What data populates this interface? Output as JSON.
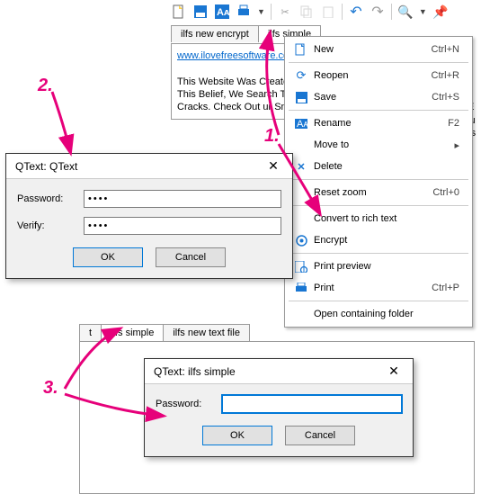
{
  "toolbar": {
    "icons": [
      "new-file-icon",
      "save-icon",
      "text-size-icon",
      "print-icon",
      "cut-icon",
      "copy-icon",
      "paste-icon",
      "undo-icon",
      "redo-icon",
      "search-icon",
      "pin-icon"
    ]
  },
  "tabs_top": [
    {
      "label": "ilfs new encrypt",
      "active": false
    },
    {
      "label": "ilfs simple",
      "active": true
    }
  ],
  "document": {
    "link": "www.ilovefreesoftware.co",
    "text": "This Website Was Created\nThis Belief, We Search Th\nCracks. Check Out  ur Sn"
  },
  "side_text": [
    "e E",
    "lu",
    "rs"
  ],
  "menu": {
    "groups": [
      [
        {
          "icon": "new-file-icon",
          "label": "New",
          "shortcut": "Ctrl+N"
        }
      ],
      [
        {
          "icon": "reopen-icon",
          "label": "Reopen",
          "shortcut": "Ctrl+R"
        },
        {
          "icon": "save-icon",
          "label": "Save",
          "shortcut": "Ctrl+S"
        }
      ],
      [
        {
          "icon": "rename-icon",
          "label": "Rename",
          "shortcut": "F2"
        },
        {
          "icon": "",
          "label": "Move to",
          "submenu": true
        },
        {
          "icon": "delete-icon",
          "label": "Delete",
          "shortcut": ""
        }
      ],
      [
        {
          "icon": "",
          "label": "Reset zoom",
          "shortcut": "Ctrl+0"
        }
      ],
      [
        {
          "icon": "",
          "label": "Convert to rich text",
          "shortcut": ""
        },
        {
          "icon": "encrypt-icon",
          "label": "Encrypt",
          "shortcut": ""
        }
      ],
      [
        {
          "icon": "preview-icon",
          "label": "Print preview",
          "shortcut": ""
        },
        {
          "icon": "print-icon",
          "label": "Print",
          "shortcut": "Ctrl+P"
        }
      ],
      [
        {
          "icon": "",
          "label": "Open containing folder",
          "shortcut": ""
        }
      ]
    ]
  },
  "dialog1": {
    "title": "QText: QText",
    "password_label": "Password:",
    "verify_label": "Verify:",
    "password_value": "••••",
    "verify_value": "••••",
    "ok": "OK",
    "cancel": "Cancel"
  },
  "tabs_bot": [
    {
      "label": "t",
      "active": false
    },
    {
      "label": "ilfs simple",
      "active": true
    },
    {
      "label": "ilfs new text file",
      "active": false
    }
  ],
  "dialog2": {
    "title": "QText: ilfs simple",
    "password_label": "Password:",
    "password_value": "",
    "ok": "OK",
    "cancel": "Cancel"
  },
  "annotations": {
    "n1": "1.",
    "n2": "2.",
    "n3": "3."
  },
  "colors": {
    "accent": "#e6007a",
    "link": "#0066cc",
    "iconblue": "#1976d2"
  }
}
